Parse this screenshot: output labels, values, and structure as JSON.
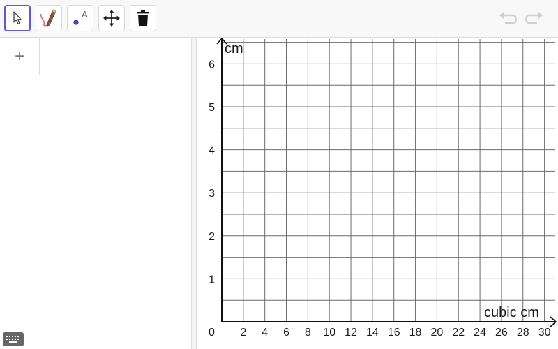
{
  "toolbar": {
    "tools": [
      {
        "name": "move-tool",
        "icon": "arrow-pointer-icon",
        "active": true
      },
      {
        "name": "pen-tool",
        "icon": "pen-icon",
        "active": false
      },
      {
        "name": "point-tool",
        "icon": "point-icon",
        "label": "A",
        "active": false
      },
      {
        "name": "move-graphics-tool",
        "icon": "move-arrows-icon",
        "active": false
      },
      {
        "name": "delete-tool",
        "icon": "trash-icon",
        "active": false
      }
    ],
    "accent_color": "#6557d2",
    "undo_icon": "undo-icon",
    "redo_icon": "redo-icon"
  },
  "algebra": {
    "add_label": "+",
    "input_underline_color": "#8e7a86"
  },
  "graph": {
    "x_axis_label": "cubic cm",
    "y_axis_label": "cm",
    "origin_label": "0",
    "x_min": 0,
    "x_max": 31,
    "y_min": 0,
    "y_max": 6.6,
    "x_grid_step": 2,
    "y_grid_step": 0.5,
    "x_ticks": [
      "2",
      "4",
      "6",
      "8",
      "10",
      "12",
      "14",
      "16",
      "18",
      "20",
      "22",
      "24",
      "26",
      "28",
      "30"
    ],
    "y_ticks": [
      "1",
      "2",
      "3",
      "4",
      "5",
      "6"
    ],
    "grid": true
  }
}
